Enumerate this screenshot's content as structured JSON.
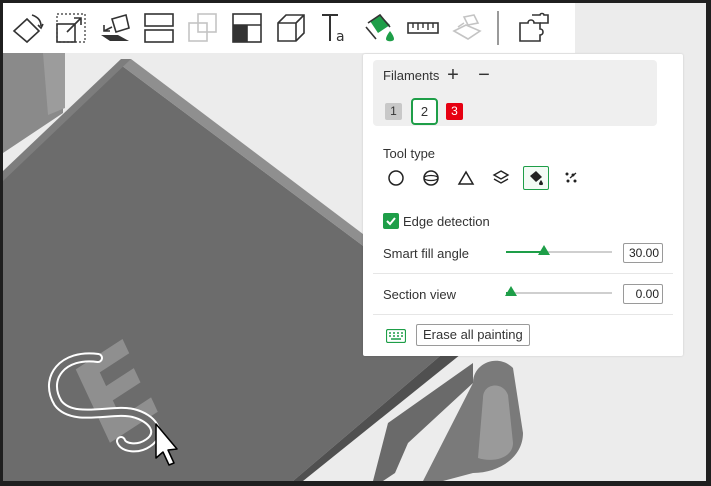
{
  "toolbar": {
    "icons": [
      "rotate-icon",
      "scale-icon",
      "place-on-face-icon",
      "split-icon",
      "arrange-icon",
      "cut-icon",
      "support-icon",
      "text-icon",
      "color-paint-icon",
      "measure-icon",
      "assembly-icon",
      "add-part-icon"
    ]
  },
  "panel": {
    "filaments_title": "Filaments",
    "add_label": "+",
    "remove_label": "−",
    "filaments": [
      {
        "id": "1",
        "color": "#c8c8c8"
      },
      {
        "id": "2",
        "color": "#ffffff"
      },
      {
        "id": "3",
        "color": "#e60012"
      }
    ],
    "tool_type_title": "Tool type",
    "tools": [
      "circle",
      "sphere",
      "triangle",
      "height-range",
      "fill",
      "gap-fill"
    ],
    "active_tool": "fill",
    "edge_detection_label": "Edge detection",
    "edge_detection_checked": true,
    "smart_fill_label": "Smart fill angle",
    "smart_fill_value": "30.00",
    "smart_fill_fraction": 0.36,
    "section_view_label": "Section view",
    "section_view_value": "0.00",
    "section_view_fraction": 0.05,
    "erase_label": "Erase all painting"
  },
  "scene": {
    "model_letter": "E",
    "accent_color": "#1e9e48"
  }
}
